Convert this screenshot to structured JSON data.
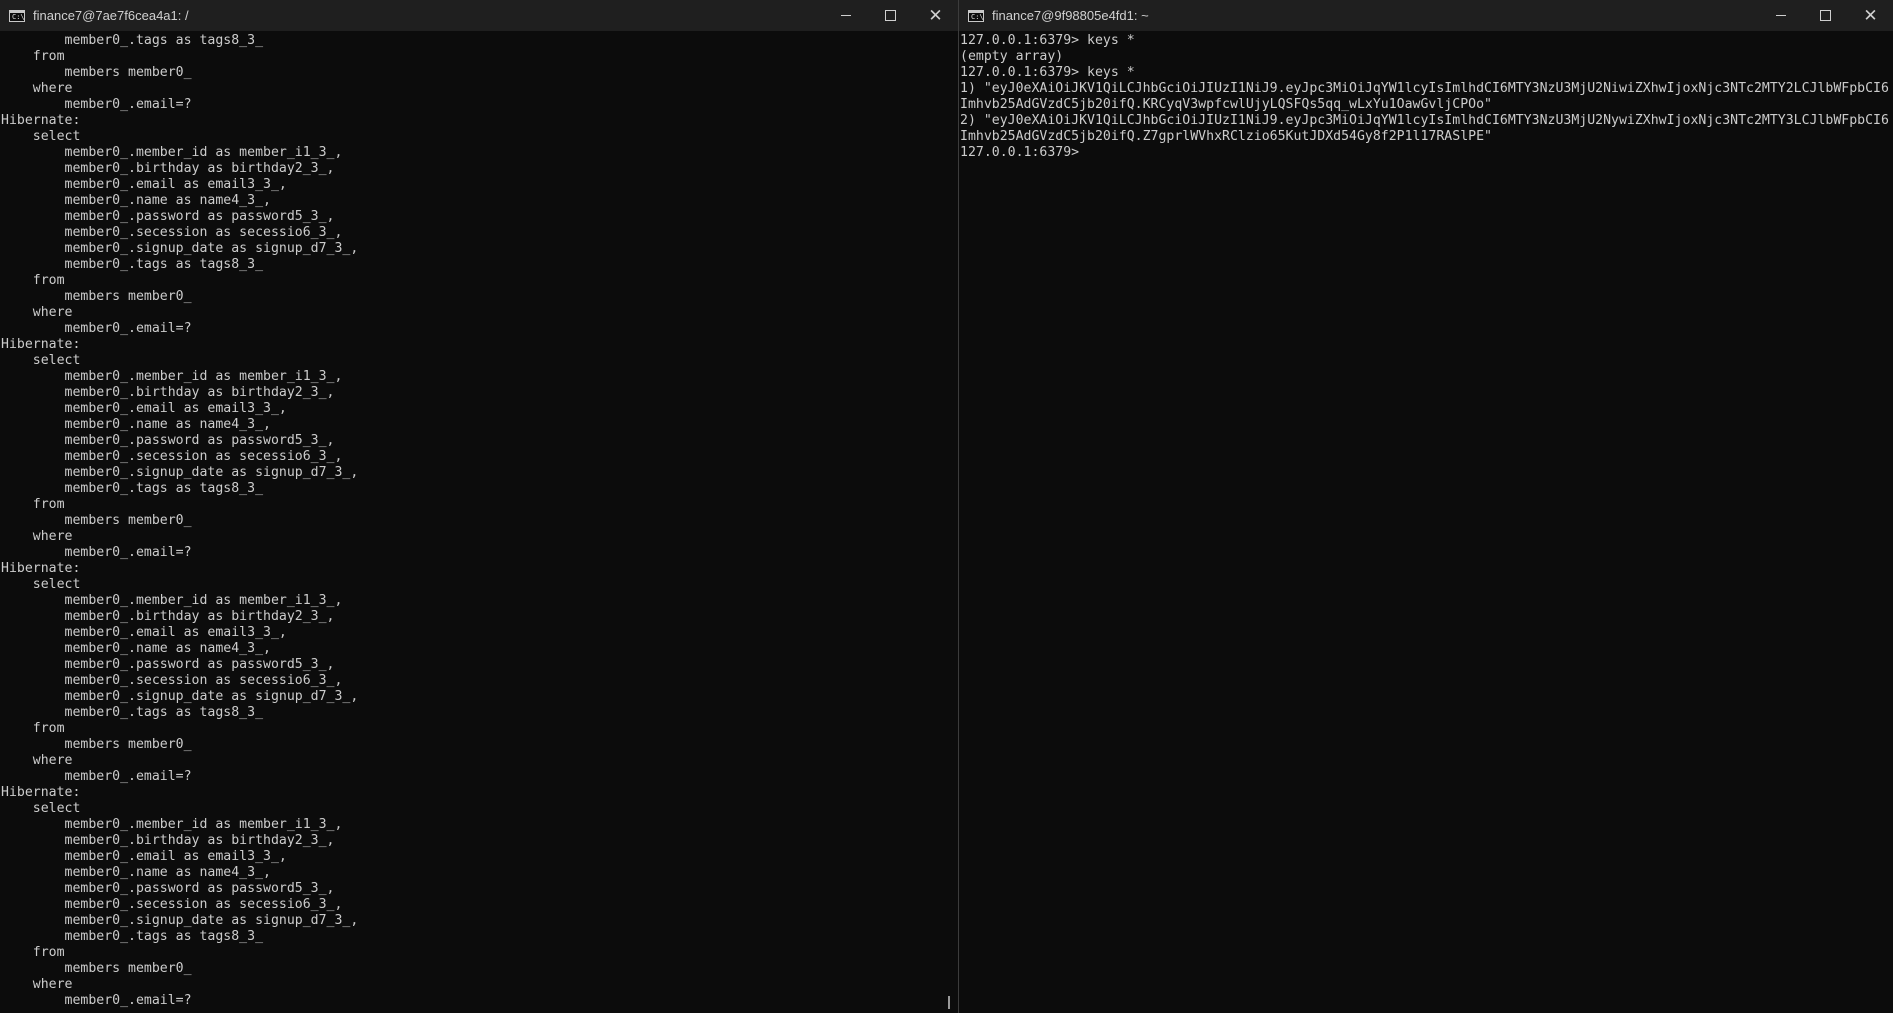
{
  "left_window": {
    "title": "finance7@7ae7f6cea4a1: /",
    "icon": "terminal-icon",
    "lines": [
      "        member0_.tags as tags8_3_",
      "    from",
      "        members member0_",
      "    where",
      "        member0_.email=?",
      "Hibernate:",
      "    select",
      "        member0_.member_id as member_i1_3_,",
      "        member0_.birthday as birthday2_3_,",
      "        member0_.email as email3_3_,",
      "        member0_.name as name4_3_,",
      "        member0_.password as password5_3_,",
      "        member0_.secession as secessio6_3_,",
      "        member0_.signup_date as signup_d7_3_,",
      "        member0_.tags as tags8_3_",
      "    from",
      "        members member0_",
      "    where",
      "        member0_.email=?",
      "Hibernate:",
      "    select",
      "        member0_.member_id as member_i1_3_,",
      "        member0_.birthday as birthday2_3_,",
      "        member0_.email as email3_3_,",
      "        member0_.name as name4_3_,",
      "        member0_.password as password5_3_,",
      "        member0_.secession as secessio6_3_,",
      "        member0_.signup_date as signup_d7_3_,",
      "        member0_.tags as tags8_3_",
      "    from",
      "        members member0_",
      "    where",
      "        member0_.email=?",
      "Hibernate:",
      "    select",
      "        member0_.member_id as member_i1_3_,",
      "        member0_.birthday as birthday2_3_,",
      "        member0_.email as email3_3_,",
      "        member0_.name as name4_3_,",
      "        member0_.password as password5_3_,",
      "        member0_.secession as secessio6_3_,",
      "        member0_.signup_date as signup_d7_3_,",
      "        member0_.tags as tags8_3_",
      "    from",
      "        members member0_",
      "    where",
      "        member0_.email=?",
      "Hibernate:",
      "    select",
      "        member0_.member_id as member_i1_3_,",
      "        member0_.birthday as birthday2_3_,",
      "        member0_.email as email3_3_,",
      "        member0_.name as name4_3_,",
      "        member0_.password as password5_3_,",
      "        member0_.secession as secessio6_3_,",
      "        member0_.signup_date as signup_d7_3_,",
      "        member0_.tags as tags8_3_",
      "    from",
      "        members member0_",
      "    where",
      "        member0_.email=?"
    ]
  },
  "right_window": {
    "title": "finance7@9f98805e4fd1: ~",
    "icon": "terminal-icon",
    "lines": [
      "127.0.0.1:6379> keys *",
      "(empty array)",
      "127.0.0.1:6379> keys *",
      "1) \"eyJ0eXAiOiJKV1QiLCJhbGciOiJIUzI1NiJ9.eyJpc3MiOiJqYW1lcyIsImlhdCI6MTY3NzU3MjU2NiwiZXhwIjoxNjc3NTc2MTY2LCJlbWFpbCI6",
      "Imhvb25AdGVzdC5jb20ifQ.KRCyqV3wpfcwlUjyLQSFQs5qq_wLxYu1OawGvljCPOo\"",
      "2) \"eyJ0eXAiOiJKV1QiLCJhbGciOiJIUzI1NiJ9.eyJpc3MiOiJqYW1lcyIsImlhdCI6MTY3NzU3MjU2NywiZXhwIjoxNjc3NTc2MTY3LCJlbWFpbCI6",
      "Imhvb25AdGVzdC5jb20ifQ.Z7gprlWVhxRClzio65KutJDXd54Gy8f2P1l17RASlPE\"",
      "127.0.0.1:6379>"
    ]
  }
}
